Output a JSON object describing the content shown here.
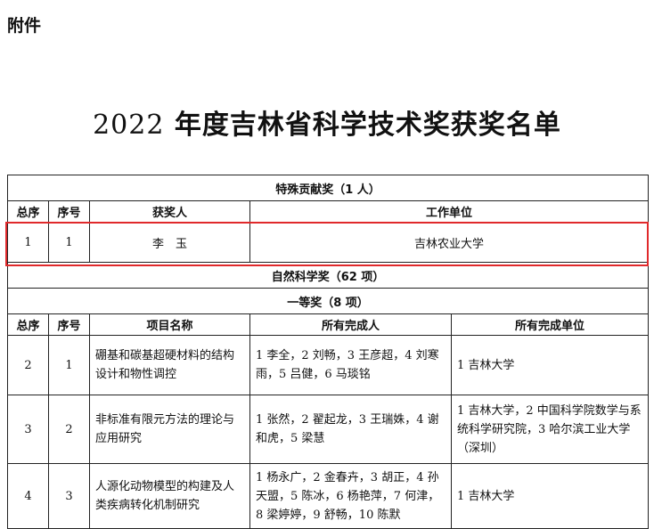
{
  "attachment_label": "附件",
  "title_year": "2022",
  "title_rest": " 年度吉林省科学技术奖获奖名单",
  "special": {
    "section": "特殊贡献奖（1 人）",
    "headers": [
      "总序",
      "序号",
      "获奖人",
      "工作单位"
    ],
    "row": {
      "total": "1",
      "seq": "1",
      "name": "李　玉",
      "unit": "吉林农业大学"
    }
  },
  "natural": {
    "section": "自然科学奖（62 项）",
    "subsection": "一等奖（8 项）",
    "headers": [
      "总序",
      "序号",
      "项目名称",
      "所有完成人",
      "所有完成单位"
    ],
    "rows": [
      {
        "total": "2",
        "seq": "1",
        "project": "硼基和碳基超硬材料的结构设计和物性调控",
        "people": "1 李全，2 刘畅，3 王彦超，4 刘寒雨，5 吕健，6 马琰铭",
        "units": "1 吉林大学"
      },
      {
        "total": "3",
        "seq": "2",
        "project": "非标准有限元方法的理论与应用研究",
        "people": "1 张然，2 翟起龙，3 王瑞姝，4 谢和虎，5 梁慧",
        "units": "1 吉林大学，2 中国科学院数学与系统科学研究院，3 哈尔滨工业大学（深圳）"
      },
      {
        "total": "4",
        "seq": "3",
        "project": "人源化动物模型的构建及人类疾病转化机制研究",
        "people": "1 杨永广，2 金春卉，3 胡正，4 孙天盟，5 陈冰，6 杨艳萍，7 何津，8 梁婷婷，9 舒畅，10 陈默",
        "units": "1 吉林大学"
      }
    ]
  }
}
